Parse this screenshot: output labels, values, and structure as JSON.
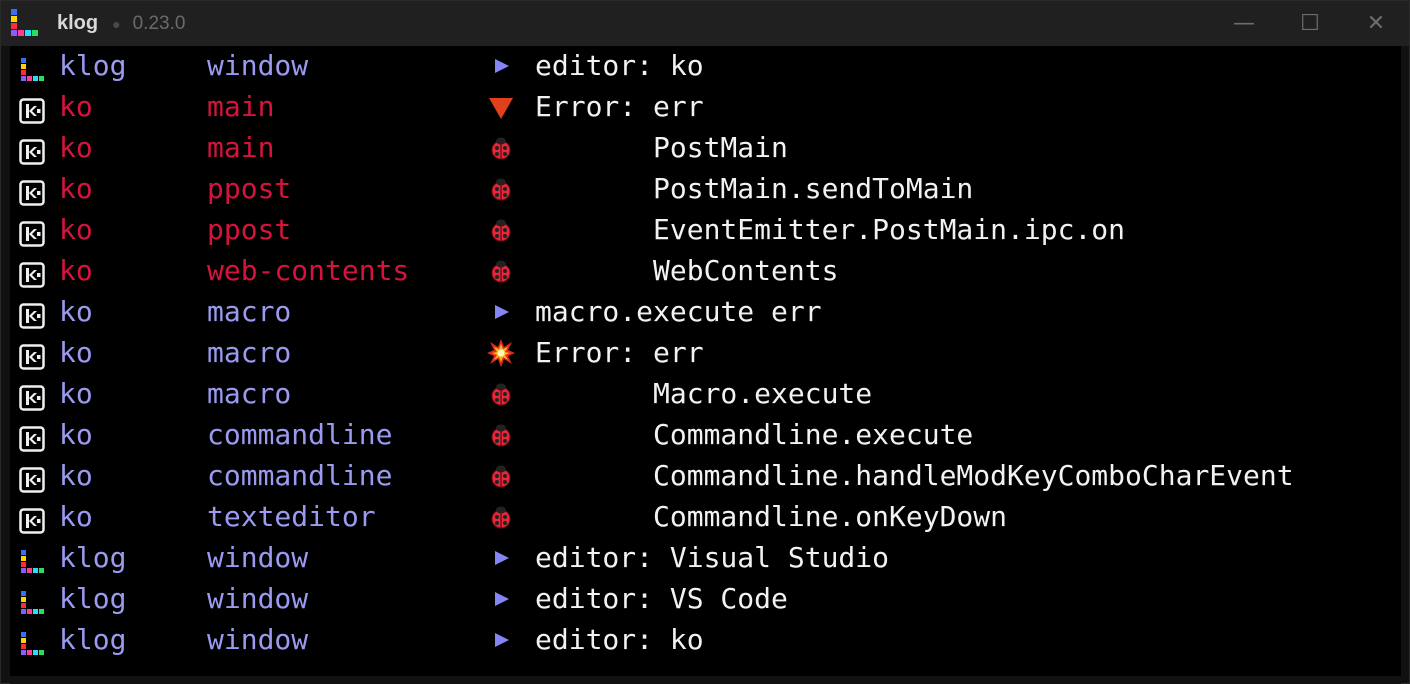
{
  "window": {
    "app_name": "klog",
    "separator": "●",
    "version": "0.23.0",
    "controls": {
      "minimize": "—",
      "maximize": "☐",
      "close": "✕"
    }
  },
  "colors": {
    "source_klog": "#9a9af0",
    "source_ko_error": "#d4143c",
    "source_ko": "#9a9af0",
    "text": "#f2f2f2",
    "triangle_blue": "#8585f5",
    "triangle_red": "#e0401c"
  },
  "log_rows": [
    {
      "src_icon": "klog-icon",
      "source": "klog",
      "module": "window",
      "type_icon": "triangle-right-icon",
      "text": "editor: ko",
      "tone": "blue"
    },
    {
      "src_icon": "ko-icon",
      "source": "ko",
      "module": "main",
      "type_icon": "triangle-down-icon",
      "text": "Error: err",
      "tone": "red"
    },
    {
      "src_icon": "ko-icon",
      "source": "ko",
      "module": "main",
      "type_icon": "bug-icon",
      "text": "       PostMain",
      "tone": "red"
    },
    {
      "src_icon": "ko-icon",
      "source": "ko",
      "module": "ppost",
      "type_icon": "bug-icon",
      "text": "       PostMain.sendToMain",
      "tone": "red"
    },
    {
      "src_icon": "ko-icon",
      "source": "ko",
      "module": "ppost",
      "type_icon": "bug-icon",
      "text": "       EventEmitter.PostMain.ipc.on",
      "tone": "red"
    },
    {
      "src_icon": "ko-icon",
      "source": "ko",
      "module": "web-contents",
      "type_icon": "bug-icon",
      "text": "       WebContents",
      "tone": "red"
    },
    {
      "src_icon": "ko-icon",
      "source": "ko",
      "module": "macro",
      "type_icon": "triangle-right-icon",
      "text": "macro.execute err",
      "tone": "blue"
    },
    {
      "src_icon": "ko-icon",
      "source": "ko",
      "module": "macro",
      "type_icon": "explosion-icon",
      "text": "Error: err",
      "tone": "blue"
    },
    {
      "src_icon": "ko-icon",
      "source": "ko",
      "module": "macro",
      "type_icon": "bug-icon",
      "text": "       Macro.execute",
      "tone": "blue"
    },
    {
      "src_icon": "ko-icon",
      "source": "ko",
      "module": "commandline",
      "type_icon": "bug-icon",
      "text": "       Commandline.execute",
      "tone": "blue"
    },
    {
      "src_icon": "ko-icon",
      "source": "ko",
      "module": "commandline",
      "type_icon": "bug-icon",
      "text": "       Commandline.handleModKeyComboCharEvent",
      "tone": "blue"
    },
    {
      "src_icon": "ko-icon",
      "source": "ko",
      "module": "texteditor",
      "type_icon": "bug-icon",
      "text": "       Commandline.onKeyDown",
      "tone": "blue"
    },
    {
      "src_icon": "klog-icon",
      "source": "klog",
      "module": "window",
      "type_icon": "triangle-right-icon",
      "text": "editor: Visual Studio",
      "tone": "blue"
    },
    {
      "src_icon": "klog-icon",
      "source": "klog",
      "module": "window",
      "type_icon": "triangle-right-icon",
      "text": "editor: VS Code",
      "tone": "blue"
    },
    {
      "src_icon": "klog-icon",
      "source": "klog",
      "module": "window",
      "type_icon": "triangle-right-icon",
      "text": "editor: ko",
      "tone": "blue"
    }
  ]
}
